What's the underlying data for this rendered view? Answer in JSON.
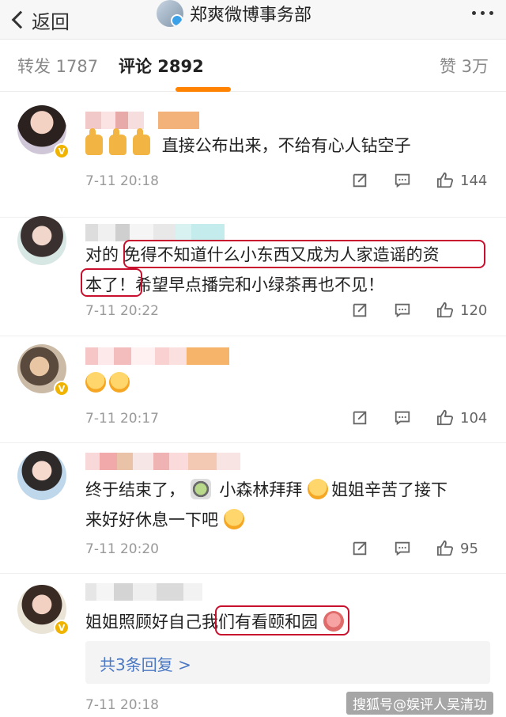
{
  "nav": {
    "back_label": "返回",
    "title": "郑爽微博事务部"
  },
  "tabs": [
    {
      "label": "转发 1787"
    },
    {
      "label": "评论 2892"
    },
    {
      "label": "赞 3万"
    }
  ],
  "comments": [
    {
      "text_parts": [
        "直接公布出来，不给有心人钻空子"
      ],
      "time": "7-11 20:18",
      "likes": "144"
    },
    {
      "text_parts": [
        "对的 免得不知道什么小东西又成为人家造谣的资",
        "本了！希望早点播完和小绿茶再也不见！"
      ],
      "time": "7-11 20:22",
      "likes": "120"
    },
    {
      "text_parts": [
        ""
      ],
      "time": "7-11 20:17",
      "likes": "104"
    },
    {
      "text_parts": [
        "终于结束了，",
        " 小森林拜拜",
        "姐姐辛苦了接下",
        "来好好休息一下吧"
      ],
      "time": "7-11 20:20",
      "likes": "95"
    },
    {
      "text_parts": [
        "姐姐照顾好自己我们有看颐和园"
      ],
      "time": "7-11 20:18",
      "reply_label": "共3条回复 >"
    }
  ],
  "watermark": "搜狐号@娱评人吴清功",
  "colors": {
    "accent": "#ff8200",
    "link": "#4a78c3",
    "circle": "#c8102e",
    "vip": "#f0b400"
  }
}
